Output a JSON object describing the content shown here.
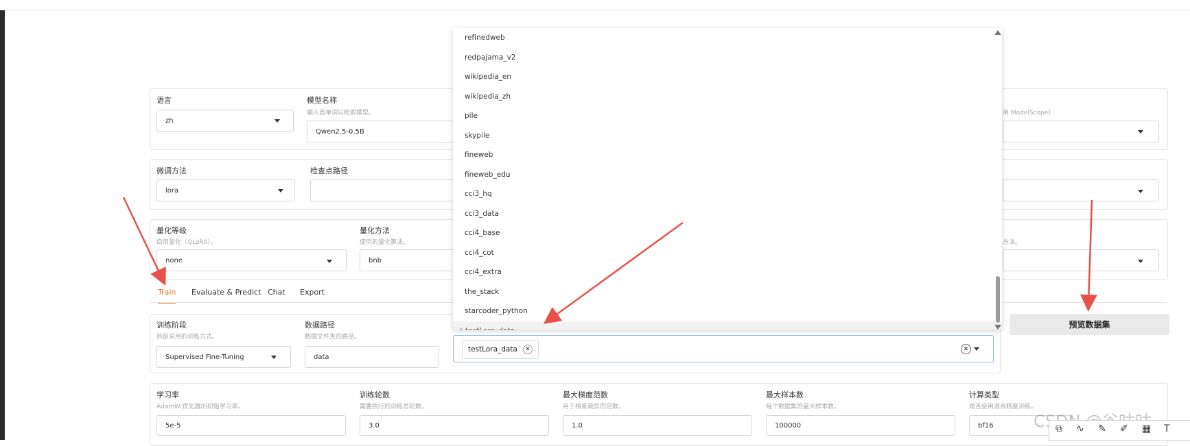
{
  "top": {
    "labels": [
      "语言",
      "模型名称"
    ]
  },
  "row1": {
    "lang_label": "语言",
    "lang_value": "zh",
    "model_label": "模型名称",
    "model_hint": "输入首单词以检索模型。",
    "model_value": "Qwen2.5-0.5B",
    "right_hint": "用 ModelScope）"
  },
  "row2": {
    "finetune_label": "微调方法",
    "finetune_value": "lora",
    "ckpt_label": "检查点路径"
  },
  "row3": {
    "quant_label": "量化等级",
    "quant_hint": "启用量化（QLoRA）。",
    "quant_value": "none",
    "qmethod_label": "量化方法",
    "qmethod_hint": "使用的量化算法。",
    "qmethod_value": "bnb",
    "right_hint": "方法。"
  },
  "tabs": [
    "Train",
    "Evaluate & Predict",
    "Chat",
    "Export"
  ],
  "train": {
    "stage_label": "训练阶段",
    "stage_hint": "目前采用的训练方式。",
    "stage_value": "Supervised Fine-Tuning",
    "dir_label": "数据路径",
    "dir_hint": "数据文件夹的路径。",
    "dir_value": "data",
    "dataset_chip": "testLora_data",
    "preview_button": "预览数据集"
  },
  "dropdown": {
    "items": [
      "refinedweb",
      "redpajama_v2",
      "wikipedia_en",
      "wikipedia_zh",
      "pile",
      "skypile",
      "fineweb",
      "fineweb_edu",
      "cci3_hq",
      "cci3_data",
      "cci4_base",
      "cci4_cot",
      "cci4_extra",
      "the_stack",
      "starcoder_python",
      "testLora_data"
    ],
    "selected_mark": "✓"
  },
  "row5": {
    "lr_label": "学习率",
    "lr_hint": "AdamW 优化器的初始学习率。",
    "lr_value": "5e-5",
    "epochs_label": "训练轮数",
    "epochs_hint": "需要执行的训练总轮数。",
    "epochs_value": "3.0",
    "grad_label": "最大梯度范数",
    "grad_hint": "用于梯度裁剪的范数。",
    "grad_value": "1.0",
    "samples_label": "最大样本数",
    "samples_hint": "每个数据集的最大样本数。",
    "samples_value": "100000",
    "compute_label": "计算类型",
    "compute_hint": "是否使用混合精度训练。",
    "compute_value": "bf16"
  },
  "watermark": "CSDN @谷咕咕",
  "colors": {
    "accent": "#e8711e",
    "arrow": "#e8504a"
  }
}
